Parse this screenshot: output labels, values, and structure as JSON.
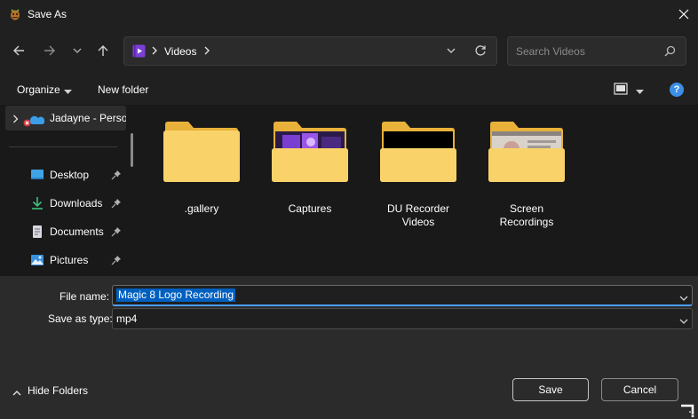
{
  "window": {
    "title": "Save As",
    "app_icon": "bug-icon",
    "close_icon": "close-icon"
  },
  "nav": {
    "back_icon": "arrow-left-icon",
    "forward_icon": "arrow-right-icon",
    "recent_icon": "chevron-down-icon",
    "up_icon": "arrow-up-icon"
  },
  "address": {
    "location_icon": "videos-folder-icon",
    "path": "Videos",
    "dropdown_icon": "chevron-down-icon",
    "refresh_icon": "refresh-icon"
  },
  "search": {
    "placeholder": "Search Videos",
    "icon": "search-icon"
  },
  "toolbar": {
    "organize_label": "Organize",
    "new_folder_label": "New folder",
    "view_icon": "view-layout-icon",
    "help_label": "?"
  },
  "sidebar": {
    "root": {
      "label": "Jadayne - Personal",
      "icon": "onedrive-cloud-icon",
      "status_icon": "sync-error-icon"
    },
    "items": [
      {
        "label": "Desktop",
        "icon": "desktop-icon",
        "pinned": true
      },
      {
        "label": "Downloads",
        "icon": "download-icon",
        "pinned": true
      },
      {
        "label": "Documents",
        "icon": "document-icon",
        "pinned": true
      },
      {
        "label": "Pictures",
        "icon": "picture-icon",
        "pinned": true
      }
    ]
  },
  "folders": [
    {
      "name": ".gallery",
      "preview": "none"
    },
    {
      "name": "Captures",
      "preview": "purple-game-thumbnail"
    },
    {
      "name": "DU Recorder\nVideos",
      "preview": "black-thumbnail"
    },
    {
      "name": "Screen\nRecordings",
      "preview": "screenshot-thumbnail"
    }
  ],
  "form": {
    "file_name_label": "File name:",
    "file_name_value": "Magic 8 Logo Recording",
    "save_type_label": "Save as type:",
    "save_type_value": "mp4"
  },
  "footer": {
    "hide_folders_label": "Hide Folders",
    "save_label": "Save",
    "cancel_label": "Cancel"
  },
  "colors": {
    "window_bg": "#202020",
    "pane_bg": "#191919",
    "footer_bg": "#2b2b2b",
    "accent": "#4a9eff",
    "selection": "#0060c0",
    "folder_back": "#e8b13a",
    "folder_front": "#f9d36a"
  }
}
